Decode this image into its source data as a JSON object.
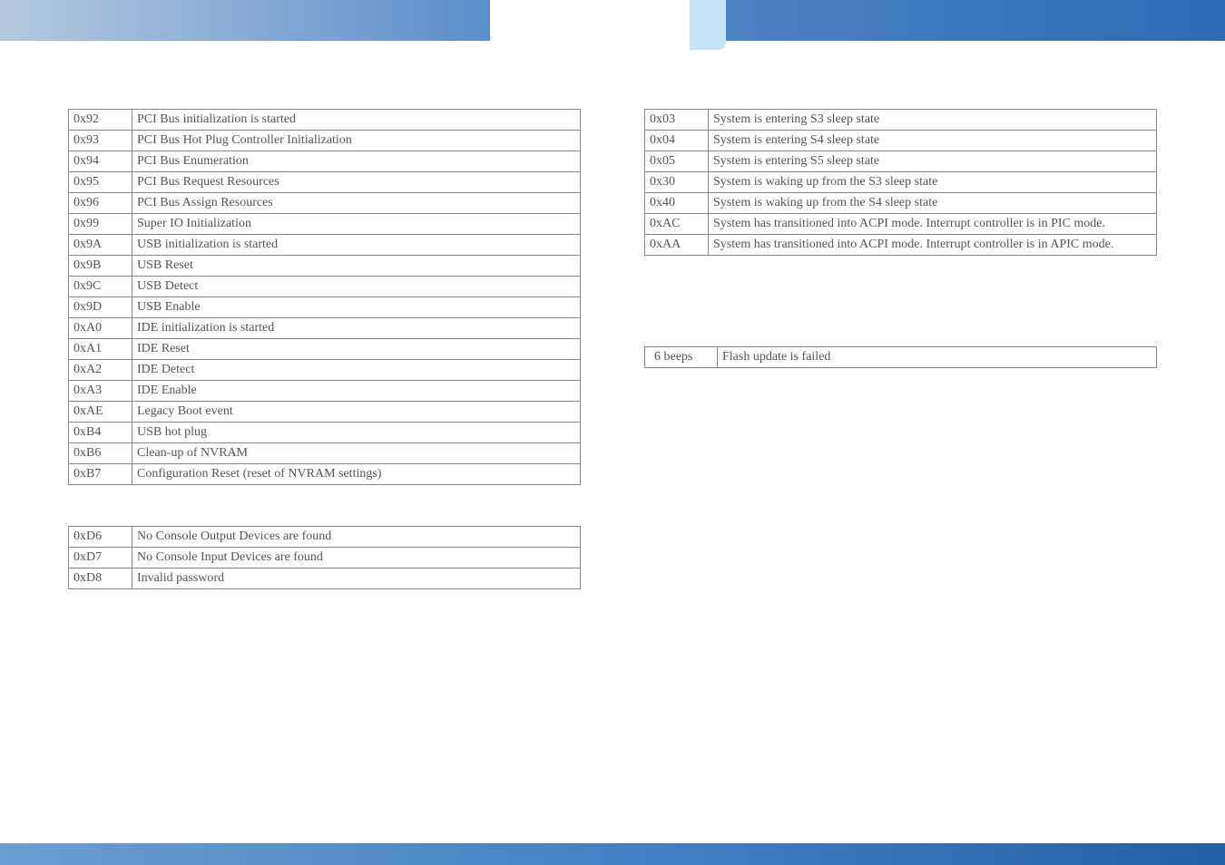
{
  "table1": [
    {
      "code": "0x92",
      "desc": "PCI Bus initialization is started"
    },
    {
      "code": "0x93",
      "desc": "PCI Bus Hot Plug Controller Initialization"
    },
    {
      "code": "0x94",
      "desc": "PCI Bus Enumeration"
    },
    {
      "code": "0x95",
      "desc": "PCI Bus Request Resources"
    },
    {
      "code": "0x96",
      "desc": "PCI Bus Assign Resources"
    },
    {
      "code": "0x99",
      "desc": "Super IO Initialization"
    },
    {
      "code": "0x9A",
      "desc": "USB initialization is started"
    },
    {
      "code": "0x9B",
      "desc": "USB Reset"
    },
    {
      "code": "0x9C",
      "desc": "USB Detect"
    },
    {
      "code": "0x9D",
      "desc": "USB Enable"
    },
    {
      "code": "0xA0",
      "desc": "IDE initialization is started"
    },
    {
      "code": "0xA1",
      "desc": "IDE Reset"
    },
    {
      "code": "0xA2",
      "desc": "IDE Detect"
    },
    {
      "code": "0xA3",
      "desc": "IDE Enable"
    },
    {
      "code": "0xAE",
      "desc": "Legacy Boot event"
    },
    {
      "code": "0xB4",
      "desc": "USB hot plug"
    },
    {
      "code": "0xB6",
      "desc": "Clean-up of NVRAM"
    },
    {
      "code": "0xB7",
      "desc": "Configuration Reset (reset of NVRAM settings)"
    }
  ],
  "table2": [
    {
      "code": "0xD6",
      "desc": "No Console Output Devices are found"
    },
    {
      "code": "0xD7",
      "desc": "No Console Input Devices are found"
    },
    {
      "code": "0xD8",
      "desc": "Invalid password"
    }
  ],
  "table3": [
    {
      "code": "0x03",
      "desc": "System is entering S3 sleep state"
    },
    {
      "code": "0x04",
      "desc": "System is entering S4 sleep state"
    },
    {
      "code": "0x05",
      "desc": "System is entering S5 sleep state"
    },
    {
      "code": "0x30",
      "desc": "System is waking up from the S3 sleep state"
    },
    {
      "code": "0x40",
      "desc": "System is waking up from the S4 sleep state"
    },
    {
      "code": "0xAC",
      "desc": "System has transitioned into ACPI mode. Interrupt controller is in PIC mode."
    },
    {
      "code": "0xAA",
      "desc": "System has transitioned into ACPI mode. Interrupt controller is in APIC mode."
    }
  ],
  "table4": [
    {
      "code": "6   beeps",
      "desc": "Flash update is failed"
    }
  ]
}
